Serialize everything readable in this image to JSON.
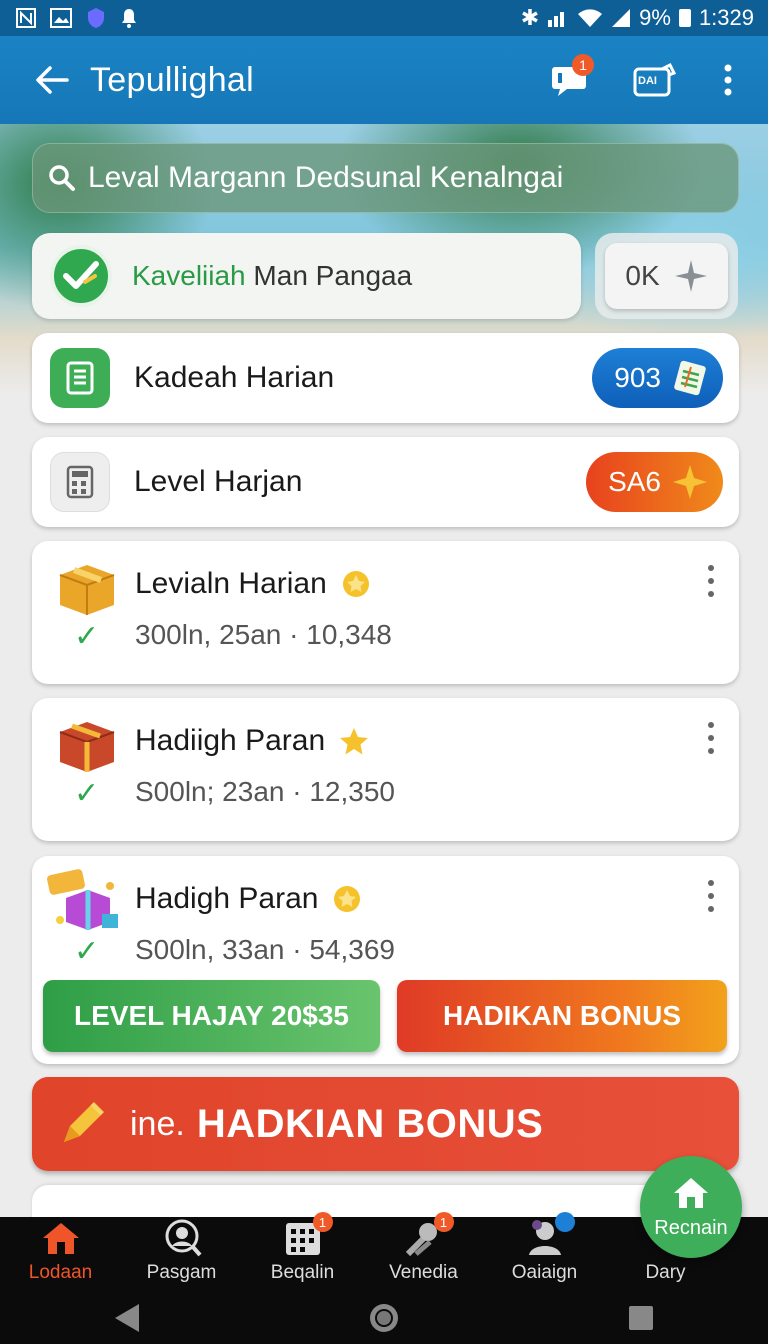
{
  "status_bar": {
    "left_icons": [
      "N",
      "image-icon",
      "shield-icon",
      "bell-icon"
    ],
    "battery_percent": "9%",
    "time": "1:329"
  },
  "app_bar": {
    "title": "Tepullighal",
    "chat_badge": "1",
    "card_label": "DAI"
  },
  "search": {
    "text": "Leval Margann Dedsunal Kenalngai"
  },
  "promo": {
    "text_green": "Kaveliiah",
    "text_dark": " Man Pangaa",
    "ok_label": "0K"
  },
  "rows": [
    {
      "title": "Kadeah Harian",
      "pill": "903"
    },
    {
      "title": "Level Harjan",
      "pill": "SA6"
    }
  ],
  "gifts": [
    {
      "title": "Levialn Harian",
      "meta": "300ln, 25an · 10,348"
    },
    {
      "title": "Hadiigh Paran",
      "meta": "S00ln; 23an · 12,350"
    },
    {
      "title": "Hadigh Paran",
      "meta": "S00ln, 33an · 54,369",
      "button_left": "LEVEL HAJAY 20$35",
      "button_right": "HADIKAN BONUS"
    }
  ],
  "banner": {
    "prefix": "ine.",
    "main": "HADKIAN BONUS"
  },
  "bottom_nav": [
    {
      "label": "Lodaan",
      "active": true
    },
    {
      "label": "Pasgam",
      "active": false
    },
    {
      "label": "Beqalin",
      "badge": "1",
      "active": false
    },
    {
      "label": "Venedia",
      "badge": "1",
      "active": false
    },
    {
      "label": "Oaiaign",
      "active": false
    },
    {
      "label": "Dary",
      "active": false
    }
  ],
  "fab": {
    "label": "Recnain"
  },
  "colors": {
    "primary": "#1677b7",
    "accent_orange": "#f05a28",
    "accent_green": "#2fa84f",
    "banner_red": "#e0442a"
  }
}
